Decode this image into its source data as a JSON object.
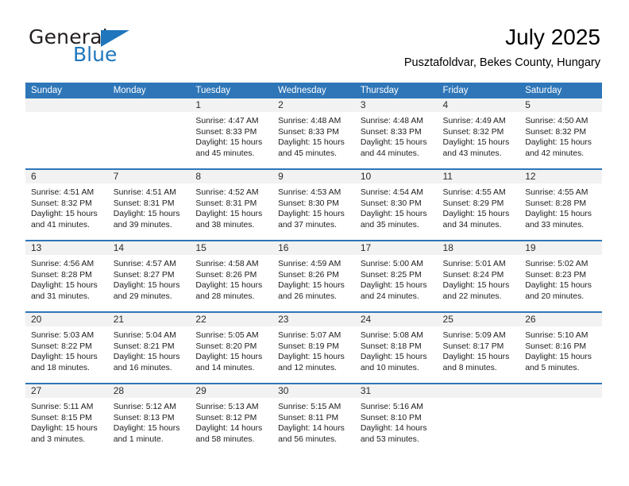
{
  "brand": {
    "word_one": "General",
    "word_two": "Blue",
    "triangle_icon": "triangle-icon",
    "accent_color": "#1f76bc"
  },
  "header": {
    "title": "July 2025",
    "subtitle": "Pusztafoldvar, Bekes County, Hungary"
  },
  "theme": {
    "header_blue": "#2e76b8",
    "band_gray": "#f2f2f2",
    "text": "#1d1d1d"
  },
  "weekday_headers": [
    "Sunday",
    "Monday",
    "Tuesday",
    "Wednesday",
    "Thursday",
    "Friday",
    "Saturday"
  ],
  "weeks": [
    [
      {
        "day": "",
        "sunrise": "",
        "sunset": "",
        "daylight_1": "",
        "daylight_2": "",
        "empty": true
      },
      {
        "day": "",
        "sunrise": "",
        "sunset": "",
        "daylight_1": "",
        "daylight_2": "",
        "empty": true
      },
      {
        "day": "1",
        "sunrise": "Sunrise: 4:47 AM",
        "sunset": "Sunset: 8:33 PM",
        "daylight_1": "Daylight: 15 hours",
        "daylight_2": "and 45 minutes."
      },
      {
        "day": "2",
        "sunrise": "Sunrise: 4:48 AM",
        "sunset": "Sunset: 8:33 PM",
        "daylight_1": "Daylight: 15 hours",
        "daylight_2": "and 45 minutes."
      },
      {
        "day": "3",
        "sunrise": "Sunrise: 4:48 AM",
        "sunset": "Sunset: 8:33 PM",
        "daylight_1": "Daylight: 15 hours",
        "daylight_2": "and 44 minutes."
      },
      {
        "day": "4",
        "sunrise": "Sunrise: 4:49 AM",
        "sunset": "Sunset: 8:32 PM",
        "daylight_1": "Daylight: 15 hours",
        "daylight_2": "and 43 minutes."
      },
      {
        "day": "5",
        "sunrise": "Sunrise: 4:50 AM",
        "sunset": "Sunset: 8:32 PM",
        "daylight_1": "Daylight: 15 hours",
        "daylight_2": "and 42 minutes."
      }
    ],
    [
      {
        "day": "6",
        "sunrise": "Sunrise: 4:51 AM",
        "sunset": "Sunset: 8:32 PM",
        "daylight_1": "Daylight: 15 hours",
        "daylight_2": "and 41 minutes."
      },
      {
        "day": "7",
        "sunrise": "Sunrise: 4:51 AM",
        "sunset": "Sunset: 8:31 PM",
        "daylight_1": "Daylight: 15 hours",
        "daylight_2": "and 39 minutes."
      },
      {
        "day": "8",
        "sunrise": "Sunrise: 4:52 AM",
        "sunset": "Sunset: 8:31 PM",
        "daylight_1": "Daylight: 15 hours",
        "daylight_2": "and 38 minutes."
      },
      {
        "day": "9",
        "sunrise": "Sunrise: 4:53 AM",
        "sunset": "Sunset: 8:30 PM",
        "daylight_1": "Daylight: 15 hours",
        "daylight_2": "and 37 minutes."
      },
      {
        "day": "10",
        "sunrise": "Sunrise: 4:54 AM",
        "sunset": "Sunset: 8:30 PM",
        "daylight_1": "Daylight: 15 hours",
        "daylight_2": "and 35 minutes."
      },
      {
        "day": "11",
        "sunrise": "Sunrise: 4:55 AM",
        "sunset": "Sunset: 8:29 PM",
        "daylight_1": "Daylight: 15 hours",
        "daylight_2": "and 34 minutes."
      },
      {
        "day": "12",
        "sunrise": "Sunrise: 4:55 AM",
        "sunset": "Sunset: 8:28 PM",
        "daylight_1": "Daylight: 15 hours",
        "daylight_2": "and 33 minutes."
      }
    ],
    [
      {
        "day": "13",
        "sunrise": "Sunrise: 4:56 AM",
        "sunset": "Sunset: 8:28 PM",
        "daylight_1": "Daylight: 15 hours",
        "daylight_2": "and 31 minutes."
      },
      {
        "day": "14",
        "sunrise": "Sunrise: 4:57 AM",
        "sunset": "Sunset: 8:27 PM",
        "daylight_1": "Daylight: 15 hours",
        "daylight_2": "and 29 minutes."
      },
      {
        "day": "15",
        "sunrise": "Sunrise: 4:58 AM",
        "sunset": "Sunset: 8:26 PM",
        "daylight_1": "Daylight: 15 hours",
        "daylight_2": "and 28 minutes."
      },
      {
        "day": "16",
        "sunrise": "Sunrise: 4:59 AM",
        "sunset": "Sunset: 8:26 PM",
        "daylight_1": "Daylight: 15 hours",
        "daylight_2": "and 26 minutes."
      },
      {
        "day": "17",
        "sunrise": "Sunrise: 5:00 AM",
        "sunset": "Sunset: 8:25 PM",
        "daylight_1": "Daylight: 15 hours",
        "daylight_2": "and 24 minutes."
      },
      {
        "day": "18",
        "sunrise": "Sunrise: 5:01 AM",
        "sunset": "Sunset: 8:24 PM",
        "daylight_1": "Daylight: 15 hours",
        "daylight_2": "and 22 minutes."
      },
      {
        "day": "19",
        "sunrise": "Sunrise: 5:02 AM",
        "sunset": "Sunset: 8:23 PM",
        "daylight_1": "Daylight: 15 hours",
        "daylight_2": "and 20 minutes."
      }
    ],
    [
      {
        "day": "20",
        "sunrise": "Sunrise: 5:03 AM",
        "sunset": "Sunset: 8:22 PM",
        "daylight_1": "Daylight: 15 hours",
        "daylight_2": "and 18 minutes."
      },
      {
        "day": "21",
        "sunrise": "Sunrise: 5:04 AM",
        "sunset": "Sunset: 8:21 PM",
        "daylight_1": "Daylight: 15 hours",
        "daylight_2": "and 16 minutes."
      },
      {
        "day": "22",
        "sunrise": "Sunrise: 5:05 AM",
        "sunset": "Sunset: 8:20 PM",
        "daylight_1": "Daylight: 15 hours",
        "daylight_2": "and 14 minutes."
      },
      {
        "day": "23",
        "sunrise": "Sunrise: 5:07 AM",
        "sunset": "Sunset: 8:19 PM",
        "daylight_1": "Daylight: 15 hours",
        "daylight_2": "and 12 minutes."
      },
      {
        "day": "24",
        "sunrise": "Sunrise: 5:08 AM",
        "sunset": "Sunset: 8:18 PM",
        "daylight_1": "Daylight: 15 hours",
        "daylight_2": "and 10 minutes."
      },
      {
        "day": "25",
        "sunrise": "Sunrise: 5:09 AM",
        "sunset": "Sunset: 8:17 PM",
        "daylight_1": "Daylight: 15 hours",
        "daylight_2": "and 8 minutes."
      },
      {
        "day": "26",
        "sunrise": "Sunrise: 5:10 AM",
        "sunset": "Sunset: 8:16 PM",
        "daylight_1": "Daylight: 15 hours",
        "daylight_2": "and 5 minutes."
      }
    ],
    [
      {
        "day": "27",
        "sunrise": "Sunrise: 5:11 AM",
        "sunset": "Sunset: 8:15 PM",
        "daylight_1": "Daylight: 15 hours",
        "daylight_2": "and 3 minutes."
      },
      {
        "day": "28",
        "sunrise": "Sunrise: 5:12 AM",
        "sunset": "Sunset: 8:13 PM",
        "daylight_1": "Daylight: 15 hours",
        "daylight_2": "and 1 minute."
      },
      {
        "day": "29",
        "sunrise": "Sunrise: 5:13 AM",
        "sunset": "Sunset: 8:12 PM",
        "daylight_1": "Daylight: 14 hours",
        "daylight_2": "and 58 minutes."
      },
      {
        "day": "30",
        "sunrise": "Sunrise: 5:15 AM",
        "sunset": "Sunset: 8:11 PM",
        "daylight_1": "Daylight: 14 hours",
        "daylight_2": "and 56 minutes."
      },
      {
        "day": "31",
        "sunrise": "Sunrise: 5:16 AM",
        "sunset": "Sunset: 8:10 PM",
        "daylight_1": "Daylight: 14 hours",
        "daylight_2": "and 53 minutes."
      },
      {
        "day": "",
        "sunrise": "",
        "sunset": "",
        "daylight_1": "",
        "daylight_2": "",
        "empty": true
      },
      {
        "day": "",
        "sunrise": "",
        "sunset": "",
        "daylight_1": "",
        "daylight_2": "",
        "empty": true
      }
    ]
  ]
}
